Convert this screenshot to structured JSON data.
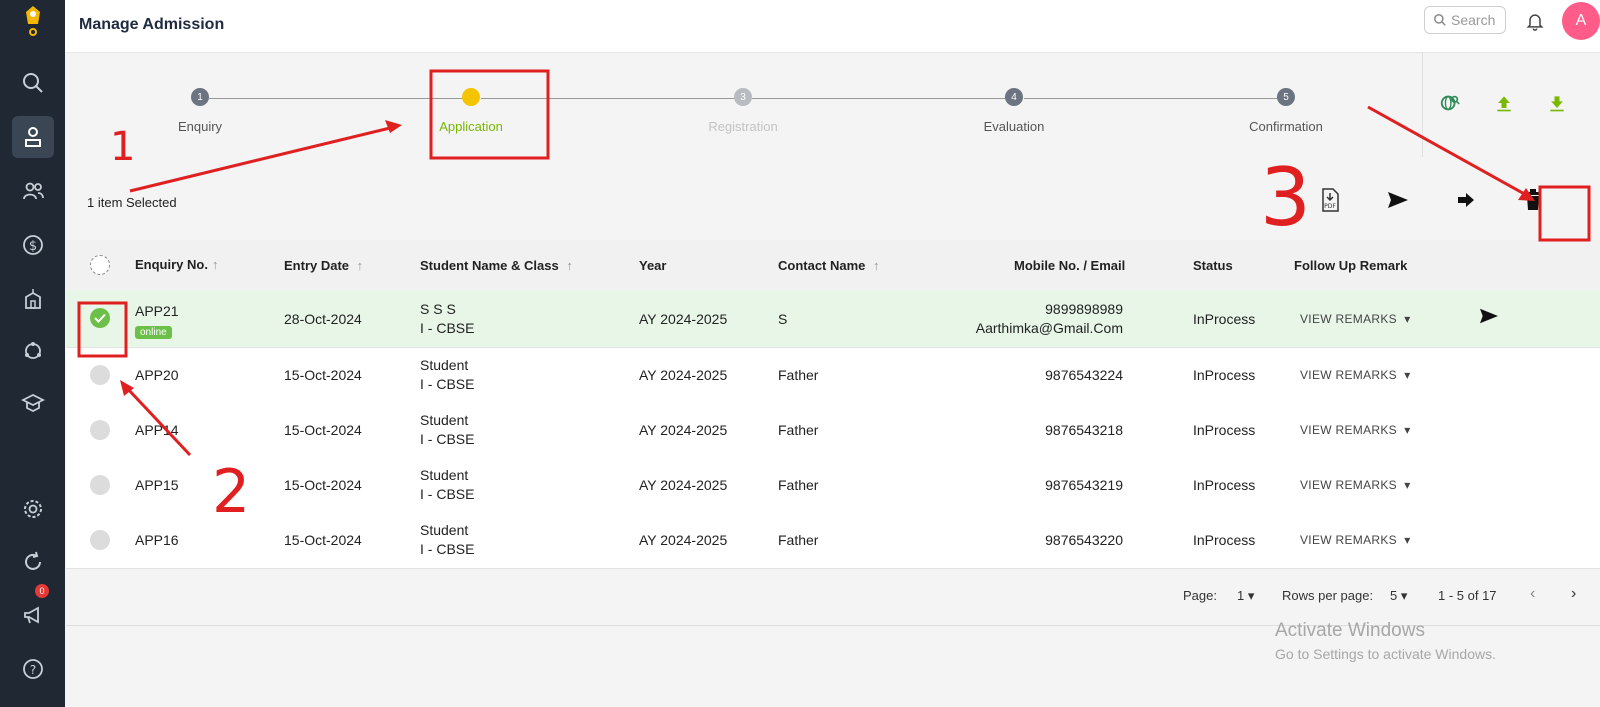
{
  "app": {
    "title": "Manage Admission"
  },
  "search": {
    "placeholder": "Search"
  },
  "user": {
    "avatar_letter": "A"
  },
  "sidebar": {
    "notification_count": "0"
  },
  "steps": [
    {
      "num": "1",
      "label": "Enquiry"
    },
    {
      "num": "",
      "label": "Application"
    },
    {
      "num": "3",
      "label": "Registration"
    },
    {
      "num": "4",
      "label": "Evaluation"
    },
    {
      "num": "5",
      "label": "Confirmation"
    }
  ],
  "selection": {
    "text": "1 item Selected"
  },
  "table": {
    "headers": {
      "enquiry_no": "Enquiry No.",
      "entry_date": "Entry Date",
      "student": "Student Name & Class",
      "year": "Year",
      "contact": "Contact Name",
      "mobile": "Mobile No. / Email",
      "status": "Status",
      "remark": "Follow Up Remark"
    },
    "rows": [
      {
        "enquiry_no": "APP21",
        "badge": "online",
        "date": "28-Oct-2024",
        "student": "S S S",
        "class": "I - CBSE",
        "year": "AY 2024-2025",
        "contact": "S",
        "mobile": "9899898989",
        "email": "Aarthimka@Gmail.Com",
        "status": "InProcess",
        "remark": "VIEW REMARKS"
      },
      {
        "enquiry_no": "APP20",
        "date": "15-Oct-2024",
        "student": "Student",
        "class": "I - CBSE",
        "year": "AY 2024-2025",
        "contact": "Father",
        "mobile": "9876543224",
        "status": "InProcess",
        "remark": "VIEW REMARKS"
      },
      {
        "enquiry_no": "APP14",
        "date": "15-Oct-2024",
        "student": "Student",
        "class": "I - CBSE",
        "year": "AY 2024-2025",
        "contact": "Father",
        "mobile": "9876543218",
        "status": "InProcess",
        "remark": "VIEW REMARKS"
      },
      {
        "enquiry_no": "APP15",
        "date": "15-Oct-2024",
        "student": "Student",
        "class": "I - CBSE",
        "year": "AY 2024-2025",
        "contact": "Father",
        "mobile": "9876543219",
        "status": "InProcess",
        "remark": "VIEW REMARKS"
      },
      {
        "enquiry_no": "APP16",
        "date": "15-Oct-2024",
        "student": "Student",
        "class": "I - CBSE",
        "year": "AY 2024-2025",
        "contact": "Father",
        "mobile": "9876543220",
        "status": "InProcess",
        "remark": "VIEW REMARKS"
      }
    ]
  },
  "pagination": {
    "page_label": "Page:",
    "page": "1",
    "rows_label": "Rows per page:",
    "rows": "5",
    "range": "1 - 5 of 17"
  },
  "watermark": {
    "line1": "Activate Windows",
    "line2": "Go to Settings to activate Windows."
  },
  "annotations": {
    "n1": "1",
    "n2": "2",
    "n3": "3"
  },
  "colors": {
    "sidebar": "#1f2833",
    "accent_green": "#6cc04a",
    "step_active": "#f5c400",
    "annotation_red": "#e02020"
  }
}
